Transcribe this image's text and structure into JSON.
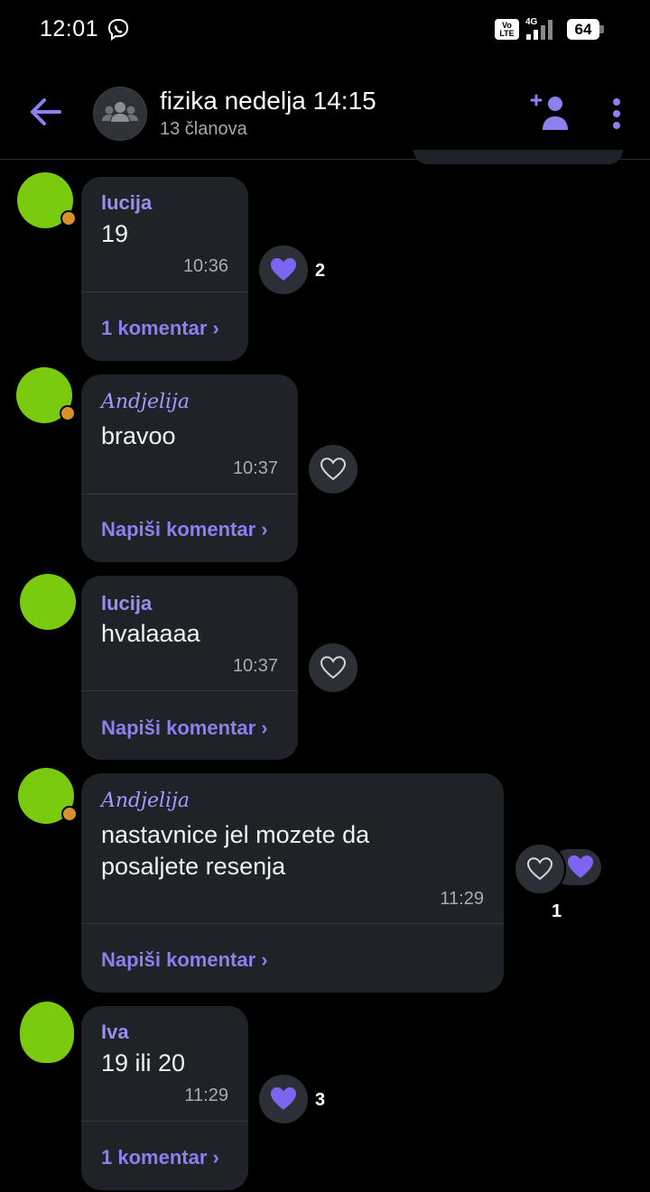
{
  "status_bar": {
    "time": "12:01",
    "network": "4G",
    "volte": "Vo LTE",
    "battery": "64"
  },
  "header": {
    "group_name": "fizika nedelja 14:15",
    "members": "13 članova"
  },
  "colors": {
    "accent": "#8c7ff0",
    "bubble": "#1f2227",
    "avatar_fill": "#7acb10",
    "heart": "#7d65f2"
  },
  "messages": [
    {
      "author": "lucija",
      "text": "19",
      "time": "10:36",
      "comment_link": "1 komentar",
      "reaction_count": "2",
      "reacted": true
    },
    {
      "author": "Andjelija",
      "text": "bravoo",
      "time": "10:37",
      "comment_link": "Napiši komentar",
      "reacted": false
    },
    {
      "author": "lucija",
      "text": "hvalaaaa",
      "time": "10:37",
      "comment_link": "Napiši komentar",
      "reacted": false
    },
    {
      "author": "Andjelija",
      "text_line1": "nastavnice jel mozete da",
      "text_line2": "posaljete resenja",
      "time": "11:29",
      "comment_link": "Napiši komentar",
      "reaction_count": "1",
      "reacted": false
    },
    {
      "author": "Iva",
      "text": "19 ili 20",
      "time": "11:29",
      "comment_link": "1 komentar",
      "reaction_count": "3",
      "reacted": true
    }
  ]
}
